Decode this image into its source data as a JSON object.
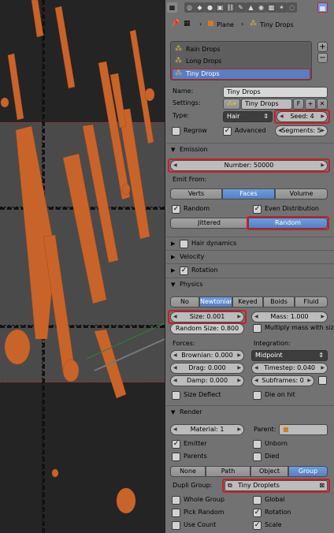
{
  "colors": {
    "accent_red": "#c8202a",
    "selected_blue": "#5680c2",
    "panel_bg": "#727272",
    "particle_orange": "#c8642a"
  },
  "breadcrumb": {
    "object": "Plane",
    "system": "Tiny Drops"
  },
  "systems_list": [
    {
      "label": "Rain Drops"
    },
    {
      "label": "Long Drops"
    },
    {
      "label": "Tiny Drops"
    }
  ],
  "settings": {
    "name_label": "Name:",
    "name_value": "Tiny Drops",
    "settings_label": "Settings:",
    "settings_value": "Tiny Drops",
    "fake_user": "F",
    "type_label": "Type:",
    "type_value": "Hair",
    "seed": "Seed: 4",
    "regrow": "Regrow",
    "advanced": "Advanced",
    "segments": "Segments: 5"
  },
  "emission": {
    "title": "Emission",
    "number": "Number: 50000",
    "emit_from": "Emit From:",
    "tabs": [
      "Verts",
      "Faces",
      "Volume"
    ],
    "random": "Random",
    "even_distribution": "Even Distribution",
    "dist_tabs": [
      "Jittered",
      "Random"
    ]
  },
  "panels": {
    "hair_dynamics": "Hair dynamics",
    "velocity": "Velocity",
    "rotation": "Rotation"
  },
  "physics": {
    "title": "Physics",
    "tabs": [
      "No",
      "Newtonian",
      "Keyed",
      "Boids",
      "Fluid"
    ],
    "size": "Size: 0.001",
    "mass": "Mass: 1.000",
    "random_size": "Random Size: 0.800",
    "multiply_mass": "Multiply mass with siz",
    "forces": "Forces:",
    "integration": "Integration:",
    "brownian": "Brownian: 0.000",
    "integration_value": "Midpoint",
    "drag": "Drag: 0.000",
    "timestep": "Timestep: 0.040",
    "damp": "Damp: 0.000",
    "subframes": "Subframes: 0",
    "size_deflect": "Size Deflect",
    "die_on_hit": "Die on hit"
  },
  "render": {
    "title": "Render",
    "material": "Material: 1",
    "parent_label": "Parent:",
    "emitter": "Emitter",
    "unborn": "Unborn",
    "parents": "Parents",
    "died": "Died",
    "tabs": [
      "None",
      "Path",
      "Object",
      "Group"
    ],
    "dupli_group_label": "Dupli Group:",
    "dupli_group_value": "Tiny Droplets",
    "whole_group": "Whole Group",
    "global": "Global",
    "pick_random": "Pick Random",
    "rotation": "Rotation",
    "use_count": "Use Count",
    "scale": "Scale"
  }
}
